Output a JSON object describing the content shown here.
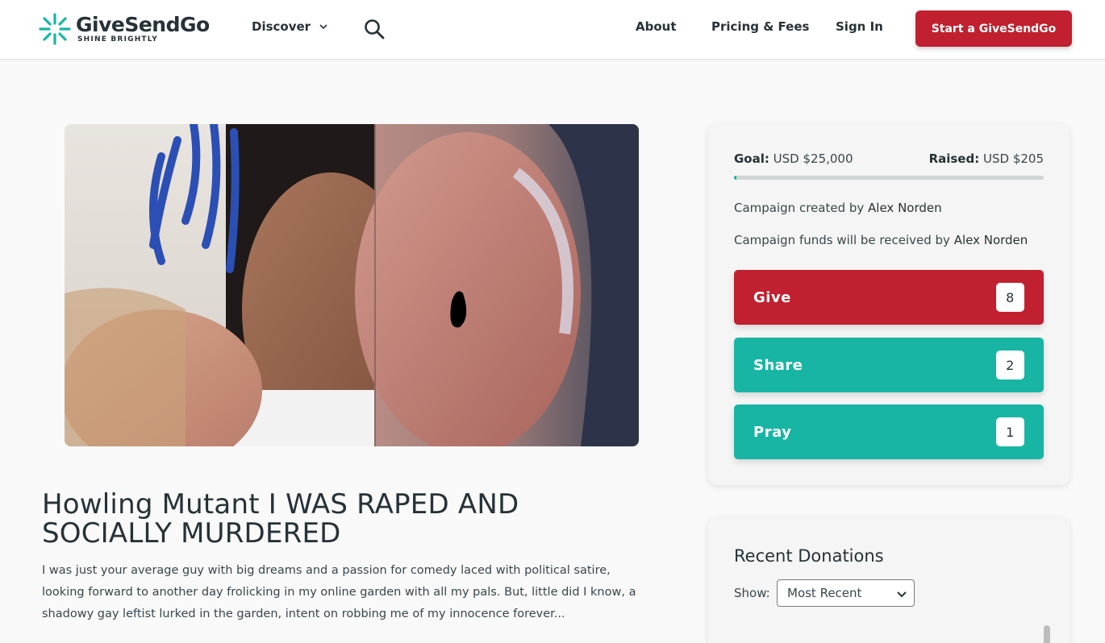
{
  "header": {
    "logo_name": "GiveSendGo",
    "logo_tagline": "SHINE BRIGHTLY",
    "discover_label": "Discover",
    "about_label": "About",
    "pricing_label": "Pricing & Fees",
    "signin_label": "Sign In",
    "start_label": "Start a GiveSendGo"
  },
  "campaign": {
    "title": "Howling Mutant I WAS RAPED AND SOCIALLY MURDERED",
    "story": " I was just your average guy with big dreams and a passion for comedy laced with political satire, looking forward to another day frolicking in my online garden with all my pals. But, little did I know, a shadowy gay leftist lurked in the garden, intent on robbing me of my innocence forever..."
  },
  "sidebar": {
    "goal_label": "Goal:",
    "goal_value": "USD $25,000",
    "raised_label": "Raised:",
    "raised_value": "USD $205",
    "progress_fraction": 0.0082,
    "created_by_text": "Campaign created by ",
    "created_by_name": "Alex Norden",
    "funds_text": "Campaign funds will be received by ",
    "funds_name": "Alex Norden",
    "actions": [
      {
        "label": "Give",
        "count": "8"
      },
      {
        "label": "Share",
        "count": "2"
      },
      {
        "label": "Pray",
        "count": "1"
      }
    ]
  },
  "recent_donations": {
    "title": "Recent Donations",
    "show_label": "Show:",
    "selected_option": "Most Recent"
  },
  "colors": {
    "brand_red": "#c0202f",
    "brand_teal": "#18b5a4",
    "text_dark": "#263238"
  }
}
